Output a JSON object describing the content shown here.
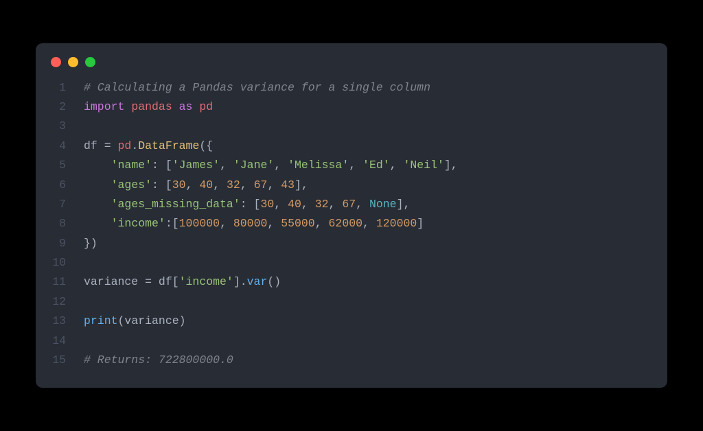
{
  "window": {
    "dots": [
      "red",
      "yellow",
      "green"
    ]
  },
  "code": {
    "lines": [
      {
        "n": "1",
        "tokens": [
          [
            "c",
            "# Calculating a Pandas variance for a single column"
          ]
        ]
      },
      {
        "n": "2",
        "tokens": [
          [
            "kw",
            "import"
          ],
          [
            "p",
            " "
          ],
          [
            "v",
            "pandas"
          ],
          [
            "p",
            " "
          ],
          [
            "kw",
            "as"
          ],
          [
            "p",
            " "
          ],
          [
            "v",
            "pd"
          ]
        ]
      },
      {
        "n": "3",
        "tokens": [
          [
            "p",
            ""
          ]
        ]
      },
      {
        "n": "4",
        "tokens": [
          [
            "p",
            "df "
          ],
          [
            "p",
            "= "
          ],
          [
            "v",
            "pd"
          ],
          [
            "p",
            "."
          ],
          [
            "cls",
            "DataFrame"
          ],
          [
            "p",
            "({"
          ]
        ]
      },
      {
        "n": "5",
        "tokens": [
          [
            "p",
            "    "
          ],
          [
            "s",
            "'name'"
          ],
          [
            "p",
            ": ["
          ],
          [
            "s",
            "'James'"
          ],
          [
            "p",
            ", "
          ],
          [
            "s",
            "'Jane'"
          ],
          [
            "p",
            ", "
          ],
          [
            "s",
            "'Melissa'"
          ],
          [
            "p",
            ", "
          ],
          [
            "s",
            "'Ed'"
          ],
          [
            "p",
            ", "
          ],
          [
            "s",
            "'Neil'"
          ],
          [
            "p",
            "],"
          ]
        ]
      },
      {
        "n": "6",
        "tokens": [
          [
            "p",
            "    "
          ],
          [
            "s",
            "'ages'"
          ],
          [
            "p",
            ": ["
          ],
          [
            "n",
            "30"
          ],
          [
            "p",
            ", "
          ],
          [
            "n",
            "40"
          ],
          [
            "p",
            ", "
          ],
          [
            "n",
            "32"
          ],
          [
            "p",
            ", "
          ],
          [
            "n",
            "67"
          ],
          [
            "p",
            ", "
          ],
          [
            "n",
            "43"
          ],
          [
            "p",
            "],"
          ]
        ]
      },
      {
        "n": "7",
        "tokens": [
          [
            "p",
            "    "
          ],
          [
            "s",
            "'ages_missing_data'"
          ],
          [
            "p",
            ": ["
          ],
          [
            "n",
            "30"
          ],
          [
            "p",
            ", "
          ],
          [
            "n",
            "40"
          ],
          [
            "p",
            ", "
          ],
          [
            "n",
            "32"
          ],
          [
            "p",
            ", "
          ],
          [
            "n",
            "67"
          ],
          [
            "p",
            ", "
          ],
          [
            "nn",
            "None"
          ],
          [
            "p",
            "],"
          ]
        ]
      },
      {
        "n": "8",
        "tokens": [
          [
            "p",
            "    "
          ],
          [
            "s",
            "'income'"
          ],
          [
            "p",
            ":["
          ],
          [
            "n",
            "100000"
          ],
          [
            "p",
            ", "
          ],
          [
            "n",
            "80000"
          ],
          [
            "p",
            ", "
          ],
          [
            "n",
            "55000"
          ],
          [
            "p",
            ", "
          ],
          [
            "n",
            "62000"
          ],
          [
            "p",
            ", "
          ],
          [
            "n",
            "120000"
          ],
          [
            "p",
            "]"
          ]
        ]
      },
      {
        "n": "9",
        "tokens": [
          [
            "p",
            "})"
          ]
        ]
      },
      {
        "n": "10",
        "tokens": [
          [
            "p",
            ""
          ]
        ]
      },
      {
        "n": "11",
        "tokens": [
          [
            "p",
            "variance = df["
          ],
          [
            "s",
            "'income'"
          ],
          [
            "p",
            "]."
          ],
          [
            "fn",
            "var"
          ],
          [
            "p",
            "()"
          ]
        ]
      },
      {
        "n": "12",
        "tokens": [
          [
            "p",
            ""
          ]
        ]
      },
      {
        "n": "13",
        "tokens": [
          [
            "fn",
            "print"
          ],
          [
            "p",
            "(variance)"
          ]
        ]
      },
      {
        "n": "14",
        "tokens": [
          [
            "p",
            ""
          ]
        ]
      },
      {
        "n": "15",
        "tokens": [
          [
            "c",
            "# Returns: 722800000.0"
          ]
        ]
      }
    ]
  }
}
